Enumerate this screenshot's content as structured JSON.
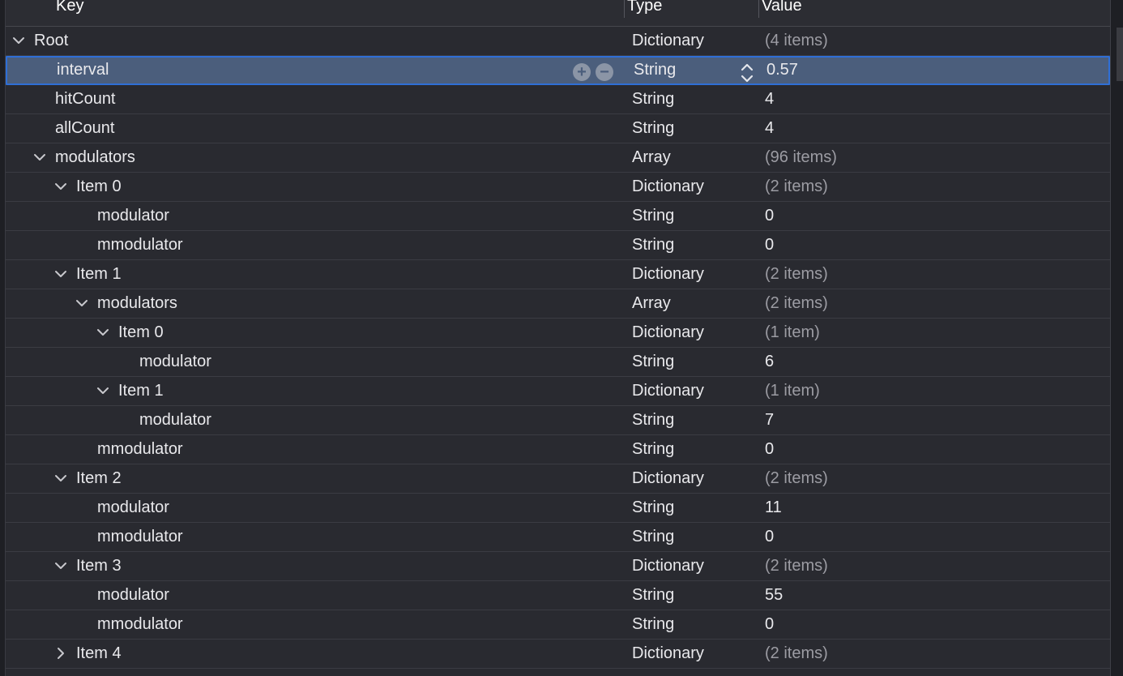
{
  "header": {
    "key_label": "Key",
    "type_label": "Type",
    "value_label": "Value"
  },
  "rows": [
    {
      "key": "Root",
      "type": "Dictionary",
      "value": "(4 items)",
      "level": 0,
      "disclosure": "expanded",
      "muted": true
    },
    {
      "key": "interval",
      "type": "String",
      "value": "0.57",
      "level": 1,
      "disclosure": "none",
      "muted": false,
      "selected": true
    },
    {
      "key": "hitCount",
      "type": "String",
      "value": "4",
      "level": 1,
      "disclosure": "none",
      "muted": false
    },
    {
      "key": "allCount",
      "type": "String",
      "value": "4",
      "level": 1,
      "disclosure": "none",
      "muted": false
    },
    {
      "key": "modulators",
      "type": "Array",
      "value": "(96 items)",
      "level": 1,
      "disclosure": "expanded",
      "muted": true
    },
    {
      "key": "Item 0",
      "type": "Dictionary",
      "value": "(2 items)",
      "level": 2,
      "disclosure": "expanded",
      "muted": true
    },
    {
      "key": "modulator",
      "type": "String",
      "value": "0",
      "level": 3,
      "disclosure": "none",
      "muted": false
    },
    {
      "key": "mmodulator",
      "type": "String",
      "value": "0",
      "level": 3,
      "disclosure": "none",
      "muted": false
    },
    {
      "key": "Item 1",
      "type": "Dictionary",
      "value": "(2 items)",
      "level": 2,
      "disclosure": "expanded",
      "muted": true
    },
    {
      "key": "modulators",
      "type": "Array",
      "value": "(2 items)",
      "level": 3,
      "disclosure": "expanded",
      "muted": true
    },
    {
      "key": "Item 0",
      "type": "Dictionary",
      "value": "(1 item)",
      "level": 4,
      "disclosure": "expanded",
      "muted": true
    },
    {
      "key": "modulator",
      "type": "String",
      "value": "6",
      "level": 5,
      "disclosure": "none",
      "muted": false
    },
    {
      "key": "Item 1",
      "type": "Dictionary",
      "value": "(1 item)",
      "level": 4,
      "disclosure": "expanded",
      "muted": true
    },
    {
      "key": "modulator",
      "type": "String",
      "value": "7",
      "level": 5,
      "disclosure": "none",
      "muted": false
    },
    {
      "key": "mmodulator",
      "type": "String",
      "value": "0",
      "level": 3,
      "disclosure": "none",
      "muted": false
    },
    {
      "key": "Item 2",
      "type": "Dictionary",
      "value": "(2 items)",
      "level": 2,
      "disclosure": "expanded",
      "muted": true
    },
    {
      "key": "modulator",
      "type": "String",
      "value": "11",
      "level": 3,
      "disclosure": "none",
      "muted": false
    },
    {
      "key": "mmodulator",
      "type": "String",
      "value": "0",
      "level": 3,
      "disclosure": "none",
      "muted": false
    },
    {
      "key": "Item 3",
      "type": "Dictionary",
      "value": "(2 items)",
      "level": 2,
      "disclosure": "expanded",
      "muted": true
    },
    {
      "key": "modulator",
      "type": "String",
      "value": "55",
      "level": 3,
      "disclosure": "none",
      "muted": false
    },
    {
      "key": "mmodulator",
      "type": "String",
      "value": "0",
      "level": 3,
      "disclosure": "none",
      "muted": false
    },
    {
      "key": "Item 4",
      "type": "Dictionary",
      "value": "(2 items)",
      "level": 2,
      "disclosure": "collapsed",
      "muted": true
    }
  ],
  "selected_row_actions": {
    "add_icon": "plus-circle-icon",
    "remove_icon": "minus-circle-icon",
    "type_stepper_icon": "up-down-chevron-icon"
  },
  "colors": {
    "background": "#292a30",
    "selection": "#4b5e7c",
    "selection_border": "#2f6fd6",
    "muted_text": "#9c9ca3"
  }
}
